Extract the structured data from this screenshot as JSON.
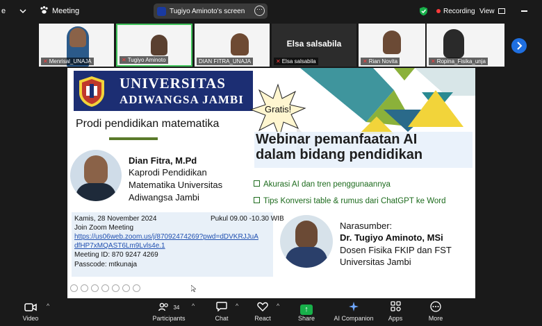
{
  "top_bar": {
    "left_fragment": "e",
    "meeting_label": "Meeting",
    "share_label": "Tugiyo Aminoto's screen",
    "recording_label": "Recording",
    "view_label": "View"
  },
  "participants_strip": [
    {
      "name": "Menrisal_UNAJA"
    },
    {
      "name": "Tugiyo Aminoto"
    },
    {
      "name": "DIAN FITRA_UNAJA"
    },
    {
      "name": "Elsa salsabila",
      "big_name": "Elsa salsabila"
    },
    {
      "name": "Rian Novita"
    },
    {
      "name": "Ropina_Fisika_unja"
    }
  ],
  "slide": {
    "university_line1": "UNIVERSITAS",
    "university_line2": "ADIWANGSA JAMBI",
    "prodi": "Prodi pendidikan matematika",
    "badge": "Gratis!",
    "title_line1": "Webinar pemanfaatan AI",
    "title_line2": "dalam bidang pendidikan",
    "bullets": [
      "Akurasi AI dan tren penggunaannya",
      "Tips Konversi table & rumus dari ChatGPT ke Word"
    ],
    "speaker1": {
      "name": "Dian Fitra, M.Pd",
      "role_line1": "Kaprodi Pendidikan",
      "role_line2": "Matematika Universitas",
      "role_line3": "Adiwangsa Jambi"
    },
    "info": {
      "date": "Kamis, 28 November 2024",
      "time": "Pukul 09.00 -10.30 WIB",
      "join": "Join Zoom Meeting",
      "link_line1": "https://us06web.zoom.us/j/87092474269?pwd=dDVKRJJuA",
      "link_line2": "dfHP7xMQAST6Lm9Lvls4e.1",
      "meeting_id": "Meeting ID: 870 9247 4269",
      "passcode": "Passcode: mtkunaja"
    },
    "narasumber": {
      "label": "Narasumber:",
      "name": "Dr. Tugiyo Aminoto, MSi",
      "line1": "Dosen Fisika FKIP dan FST",
      "line2": "Universitas Jambi"
    }
  },
  "bottom_bar": {
    "video": "Video",
    "participants": "Participants",
    "participants_count": "34",
    "chat": "Chat",
    "react": "React",
    "share": "Share",
    "ai_companion": "AI Companion",
    "apps": "Apps",
    "more": "More"
  },
  "colors": {
    "brand_navy": "#1c2e73",
    "zoom_blue": "#1f6fe0",
    "share_green": "#18b04a",
    "recording_red": "#ff3b3b",
    "accent_yellow": "#f2d43a",
    "accent_teal": "#2a8a92",
    "accent_green": "#8bb13a"
  }
}
